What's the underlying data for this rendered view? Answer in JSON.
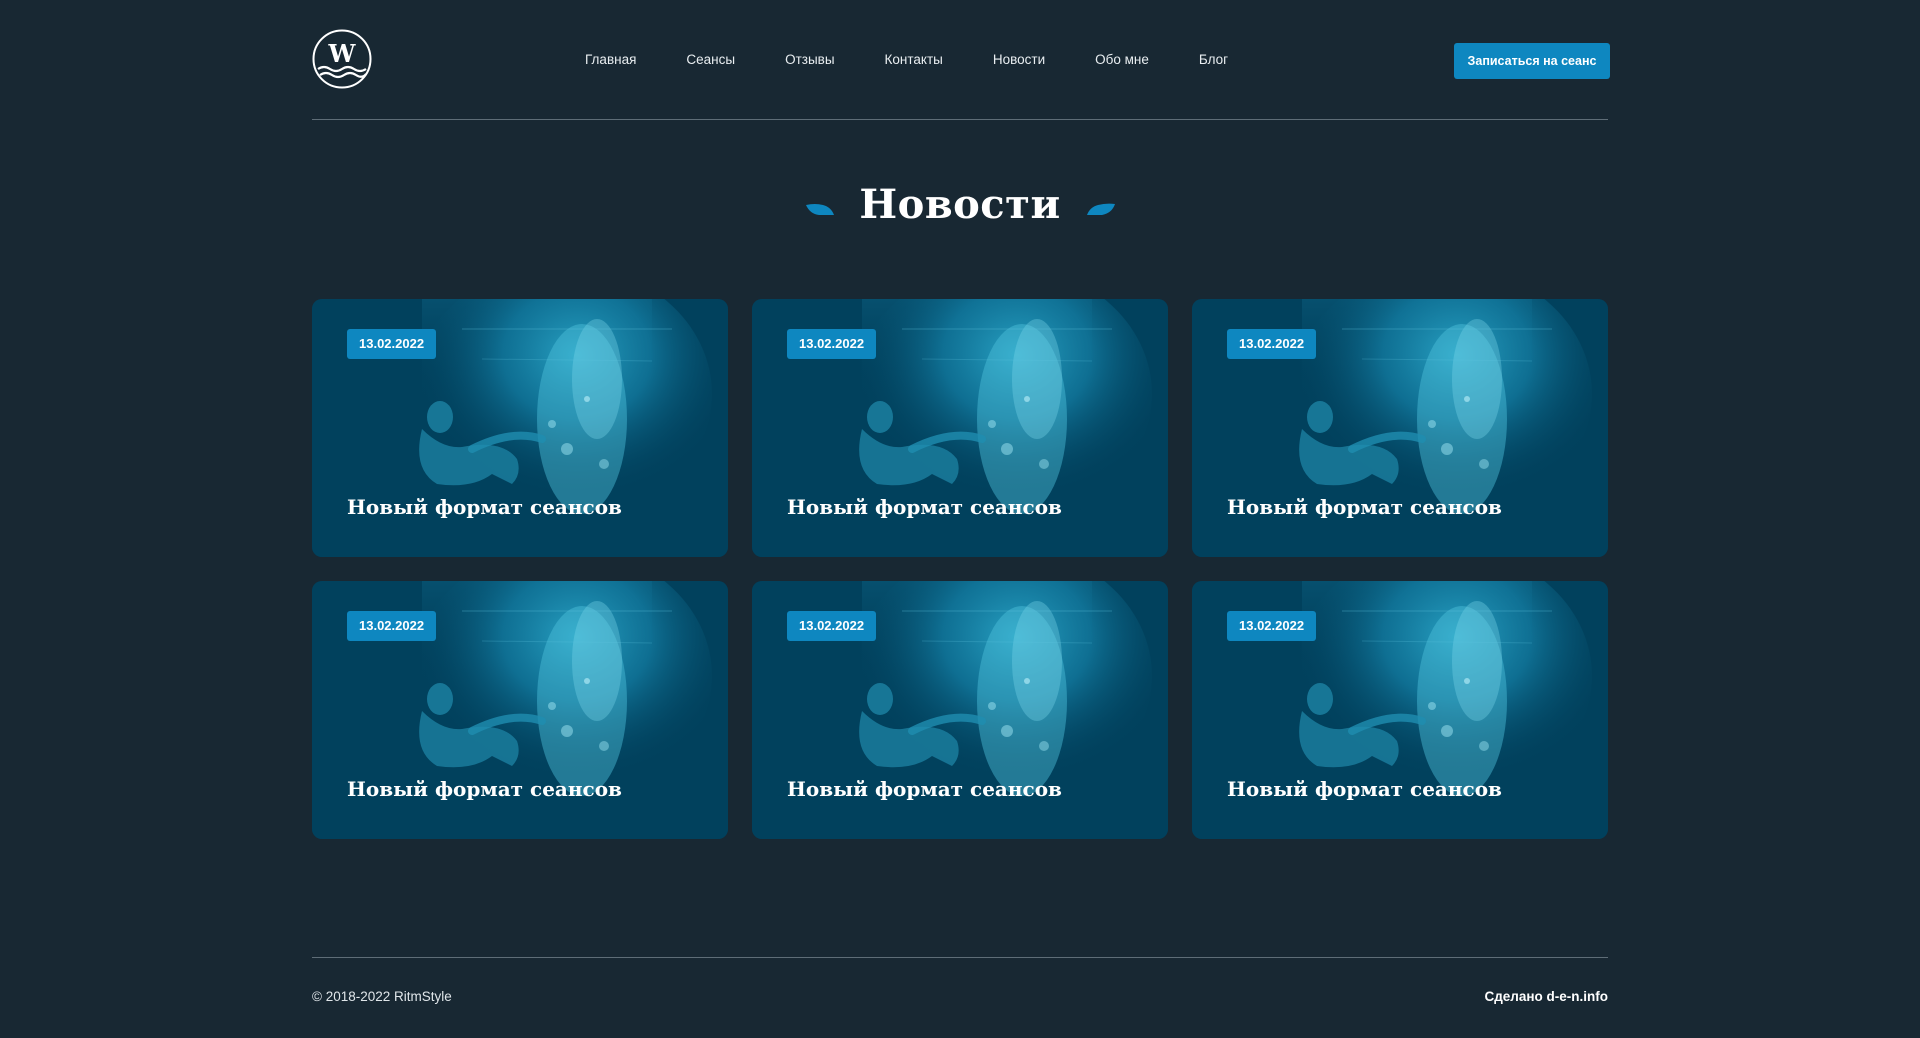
{
  "header": {
    "logo_letter": "W",
    "nav": [
      {
        "label": "Главная"
      },
      {
        "label": "Сеансы"
      },
      {
        "label": "Отзывы"
      },
      {
        "label": "Контакты"
      },
      {
        "label": "Новости"
      },
      {
        "label": "Обо мне"
      },
      {
        "label": "Блог"
      }
    ],
    "cta_label": "Записаться на сеанс"
  },
  "page": {
    "title": "Новости"
  },
  "news": [
    {
      "date": "13.02.2022",
      "title": "Новый формат сеансов"
    },
    {
      "date": "13.02.2022",
      "title": "Новый формат сеансов"
    },
    {
      "date": "13.02.2022",
      "title": "Новый формат сеансов"
    },
    {
      "date": "13.02.2022",
      "title": "Новый формат сеансов"
    },
    {
      "date": "13.02.2022",
      "title": "Новый формат сеансов"
    },
    {
      "date": "13.02.2022",
      "title": "Новый формат сеансов"
    }
  ],
  "footer": {
    "copyright": "© 2018-2022 RitmStyle",
    "made_by": "Сделано d-e-n.info"
  },
  "colors": {
    "background": "#182833",
    "accent": "#0e87c0",
    "card": "#01415d"
  }
}
